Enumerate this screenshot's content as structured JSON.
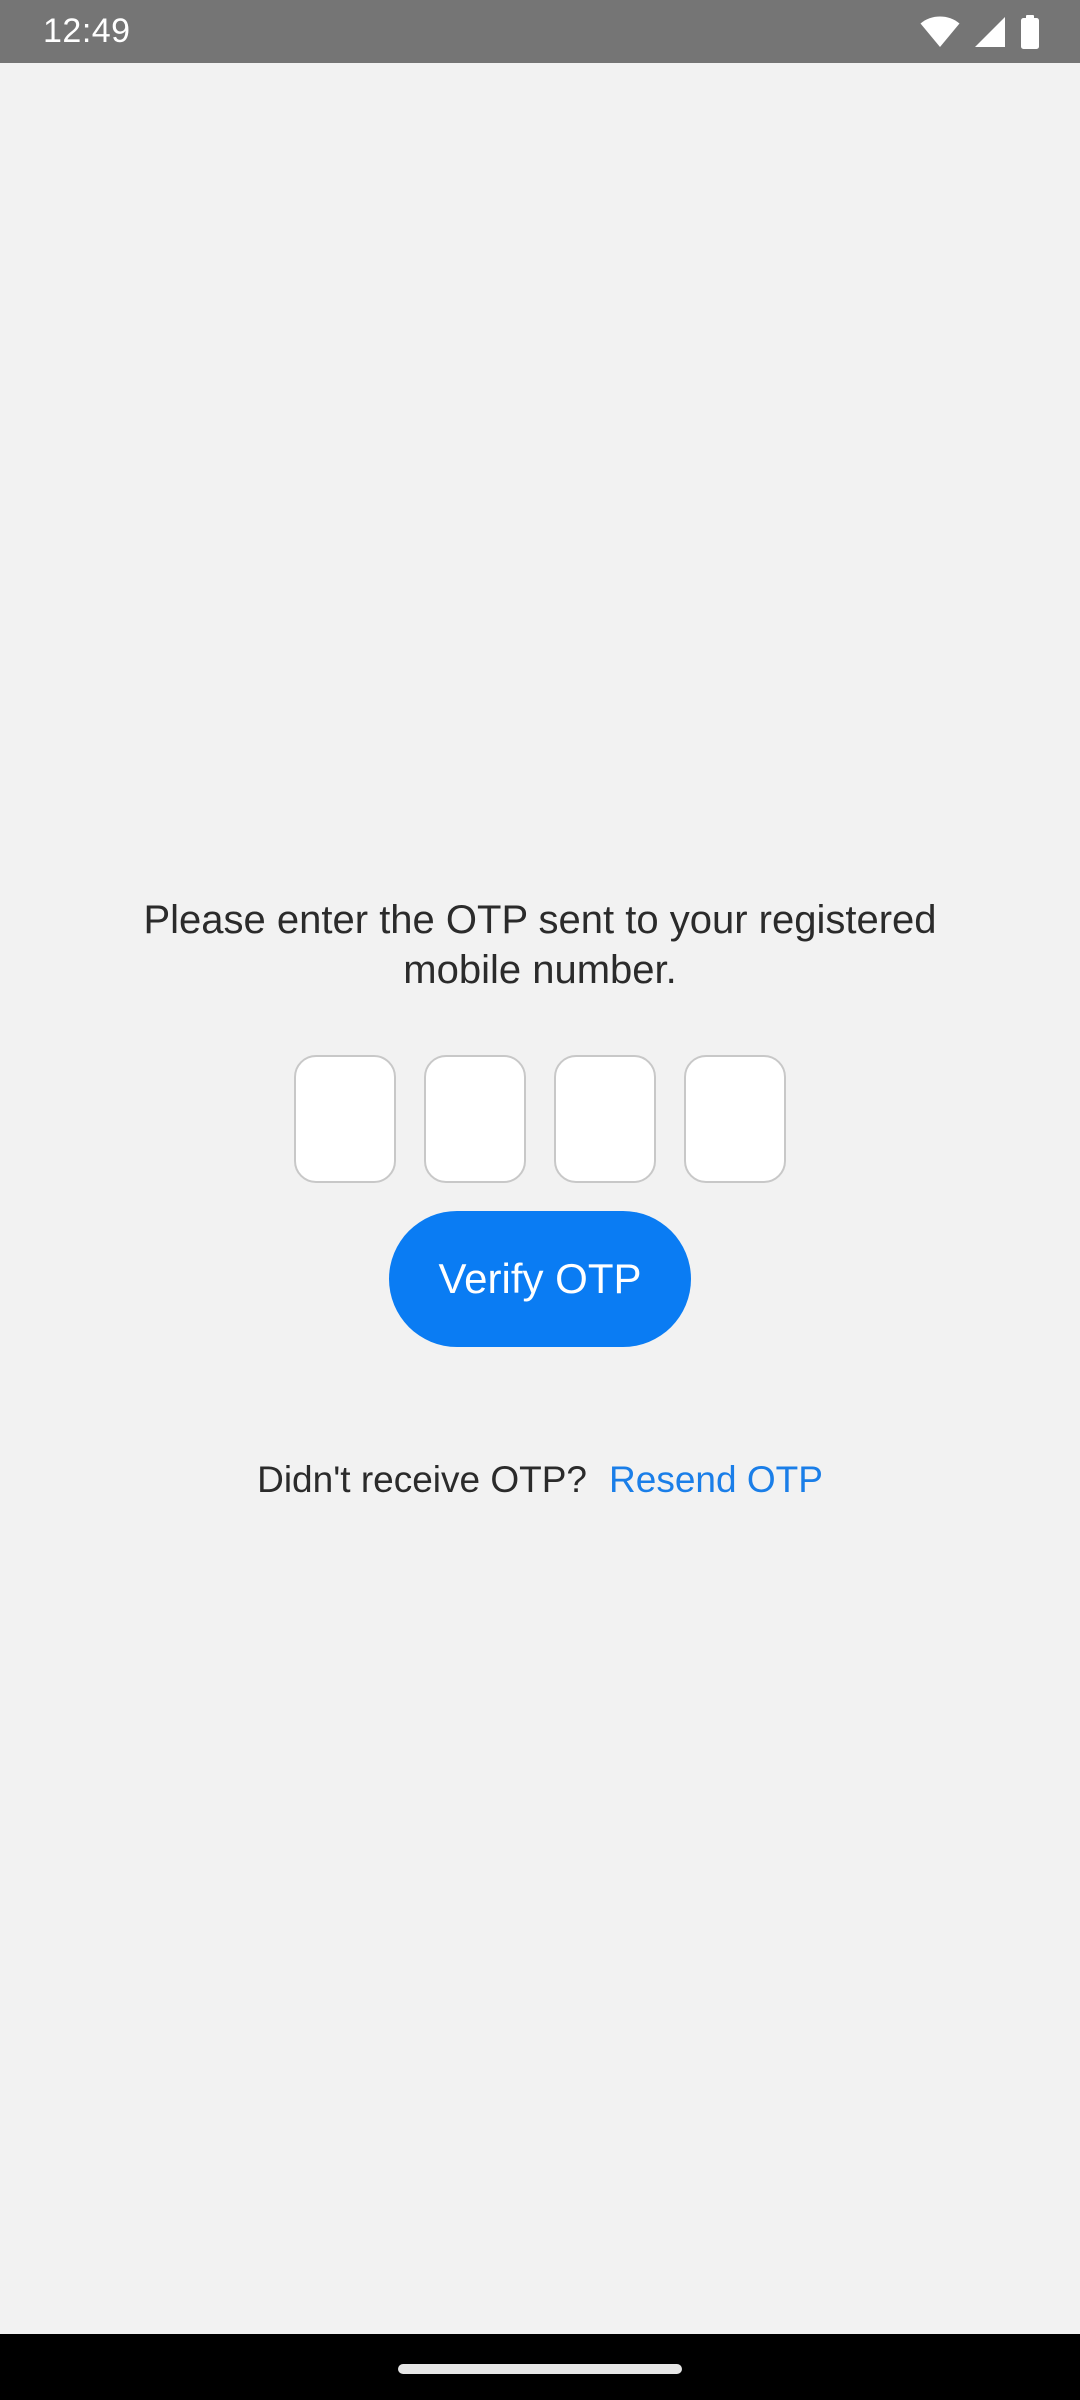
{
  "status_bar": {
    "time": "12:49",
    "icons": [
      "wifi-icon",
      "cellular-signal-icon",
      "battery-icon"
    ]
  },
  "otp": {
    "instruction_line1": "Please enter the OTP sent to your registered",
    "instruction_line2": "mobile number.",
    "digits": [
      "",
      "",
      "",
      ""
    ],
    "verify_label": "Verify OTP",
    "resend_prompt": "Didn't receive OTP?",
    "resend_label": "Resend OTP"
  },
  "colors": {
    "accent": "#0a7cf3",
    "link": "#1a7ee8",
    "background": "#f2f2f2",
    "status_bar": "#757575"
  }
}
